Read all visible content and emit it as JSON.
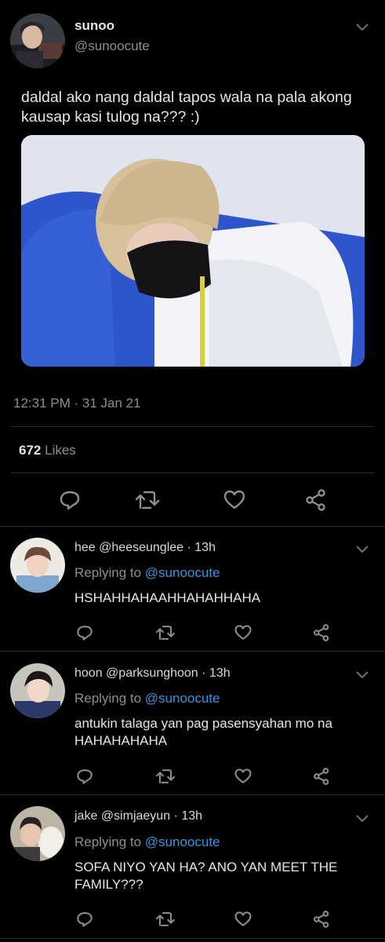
{
  "tweet": {
    "author_name": "sunoo",
    "author_handle": "@sunoocute",
    "text": "daldal ako nang daldal tapos wala na pala akong kausap kasi tulog na??? :)",
    "timestamp": "12:31 PM · 31 Jan 21",
    "likes_count": "672",
    "likes_label": "Likes"
  },
  "actions": [
    "reply-icon",
    "retweet-icon",
    "like-icon",
    "share-icon"
  ],
  "replies": [
    {
      "name": "hee",
      "handle": "@heeseunglee",
      "time": "· 13h",
      "replying_prefix": "Replying to",
      "replying_to": "@sunoocute",
      "text": "HSHAHHAHAAHHAHAHHAHA"
    },
    {
      "name": "hoon",
      "handle": "@parksunghoon",
      "time": "· 13h",
      "replying_prefix": "Replying to",
      "replying_to": "@sunoocute",
      "text": "antukin talaga yan pag pasensyahan mo na HAHAHAHAHA"
    },
    {
      "name": "jake",
      "handle": "@simjaeyun",
      "time": "· 13h",
      "replying_prefix": "Replying to",
      "replying_to": "@sunoocute",
      "text": "SOFA NIYO YAN HA? ANO YAN MEET THE FAMILY???"
    }
  ],
  "colors": {
    "background": "#000000",
    "text_primary": "#e6e6e6",
    "text_secondary": "#8b8f94",
    "link": "#3b94d9",
    "divider": "#2a2d31"
  }
}
